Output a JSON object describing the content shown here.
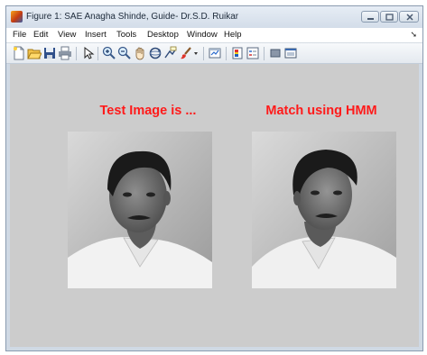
{
  "window": {
    "title": "Figure 1: SAE Anagha Shinde, Guide- Dr.S.D. Ruikar",
    "icon": "matlab-figure-icon",
    "controls": [
      "minimize-icon",
      "maximize-icon",
      "close-icon"
    ]
  },
  "menu": {
    "items": [
      "File",
      "Edit",
      "View",
      "Insert",
      "Tools",
      "Desktop",
      "Window",
      "Help"
    ],
    "overflow_arrow": "➘"
  },
  "toolbar": {
    "tools": [
      "new-file-icon",
      "open-folder-icon",
      "save-icon",
      "print-icon",
      "select-arrow-icon",
      "zoom-in-icon",
      "zoom-out-icon",
      "pan-hand-icon",
      "rotate-3d-icon",
      "data-cursor-icon",
      "brush-icon",
      "brush-dropdown-icon",
      "link-plot-icon",
      "insert-colorbar-icon",
      "insert-legend-icon",
      "hide-plot-tools-icon",
      "show-plot-tools-icon"
    ]
  },
  "figure": {
    "background": "#cccccc",
    "left_panel": {
      "title": "Test Image is ...",
      "image": "grayscale portrait photo of a man in a white shirt, facing slightly left"
    },
    "right_panel": {
      "title": "Match using HMM",
      "image": "grayscale portrait photo of the same man, head tilted, facing slightly right"
    },
    "title_color": "#ff1a1a"
  }
}
